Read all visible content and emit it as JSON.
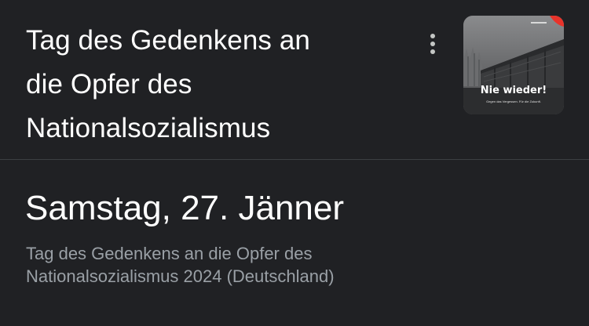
{
  "header": {
    "title_lines": [
      "Tag des Gedenkens an",
      "die Opfer des",
      "Nationalsozialismus"
    ],
    "more_icon": "more-vert-icon",
    "thumbnail": {
      "title": "Nie wieder!",
      "subtitle": "Gegen das Vergessen. Für die Zukunft.",
      "accent_color": "#e8332a"
    }
  },
  "event": {
    "date": "Samstag, 27. Jänner",
    "description_lines": [
      "Tag des Gedenkens an die Opfer des",
      "Nationalsozialismus 2024 (Deutschland)"
    ]
  },
  "colors": {
    "background": "#202124",
    "title": "#ffffff",
    "description": "#9aa0a6",
    "divider": "#3c4043"
  }
}
